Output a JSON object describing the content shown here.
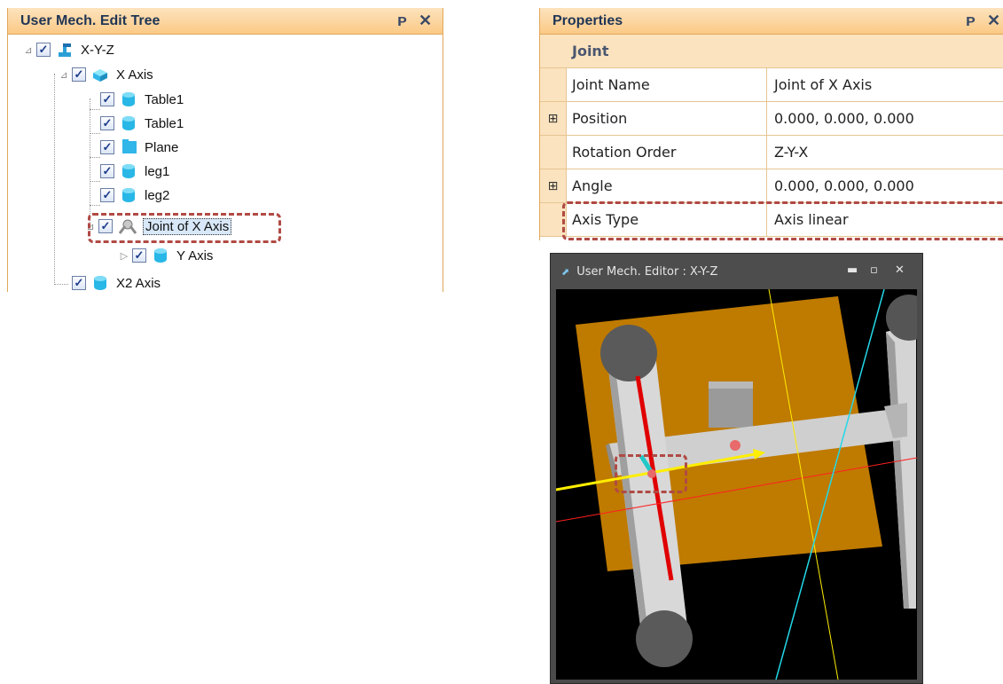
{
  "tree_panel": {
    "title": "User Mech. Edit Tree",
    "pin_icon": "pin-icon",
    "close_icon": "close-icon",
    "nodes": [
      {
        "label": "X-Y-Z",
        "icon": "robot-icon"
      },
      {
        "label": "X Axis",
        "icon": "box-icon"
      },
      {
        "label": "Table1",
        "icon": "cylinder-icon"
      },
      {
        "label": "Table1",
        "icon": "cylinder-icon"
      },
      {
        "label": "Plane",
        "icon": "plane-icon"
      },
      {
        "label": "leg1",
        "icon": "cylinder-icon"
      },
      {
        "label": "leg2",
        "icon": "cylinder-icon"
      },
      {
        "label": "Joint of X Axis",
        "icon": "joint-icon",
        "selected": true
      },
      {
        "label": "Y Axis",
        "icon": "cylinder-icon"
      },
      {
        "label": "X2 Axis",
        "icon": "cylinder-icon"
      }
    ]
  },
  "props_panel": {
    "title": "Properties",
    "category": "Joint",
    "rows": [
      {
        "name": "Joint Name",
        "value": "Joint of X Axis",
        "expandable": false
      },
      {
        "name": "Position",
        "value": "0.000, 0.000, 0.000",
        "expandable": true
      },
      {
        "name": "Rotation Order",
        "value": "Z-Y-X",
        "expandable": false
      },
      {
        "name": "Angle",
        "value": "0.000, 0.000, 0.000",
        "expandable": true
      },
      {
        "name": "Axis Type",
        "value": "Axis linear",
        "expandable": false
      }
    ]
  },
  "editor": {
    "title": "User Mech. Editor : X-Y-Z",
    "minimize_label": "▬",
    "maximize_label": "▫",
    "close_label": "✕"
  },
  "colors": {
    "header_bg": "#fbc985",
    "callout": "#b04a44",
    "plate": "#bf7a00",
    "x_axis_line": "#ff2020",
    "y_axis_line": "#ffee00",
    "z_axis_line": "#22d8e8"
  }
}
